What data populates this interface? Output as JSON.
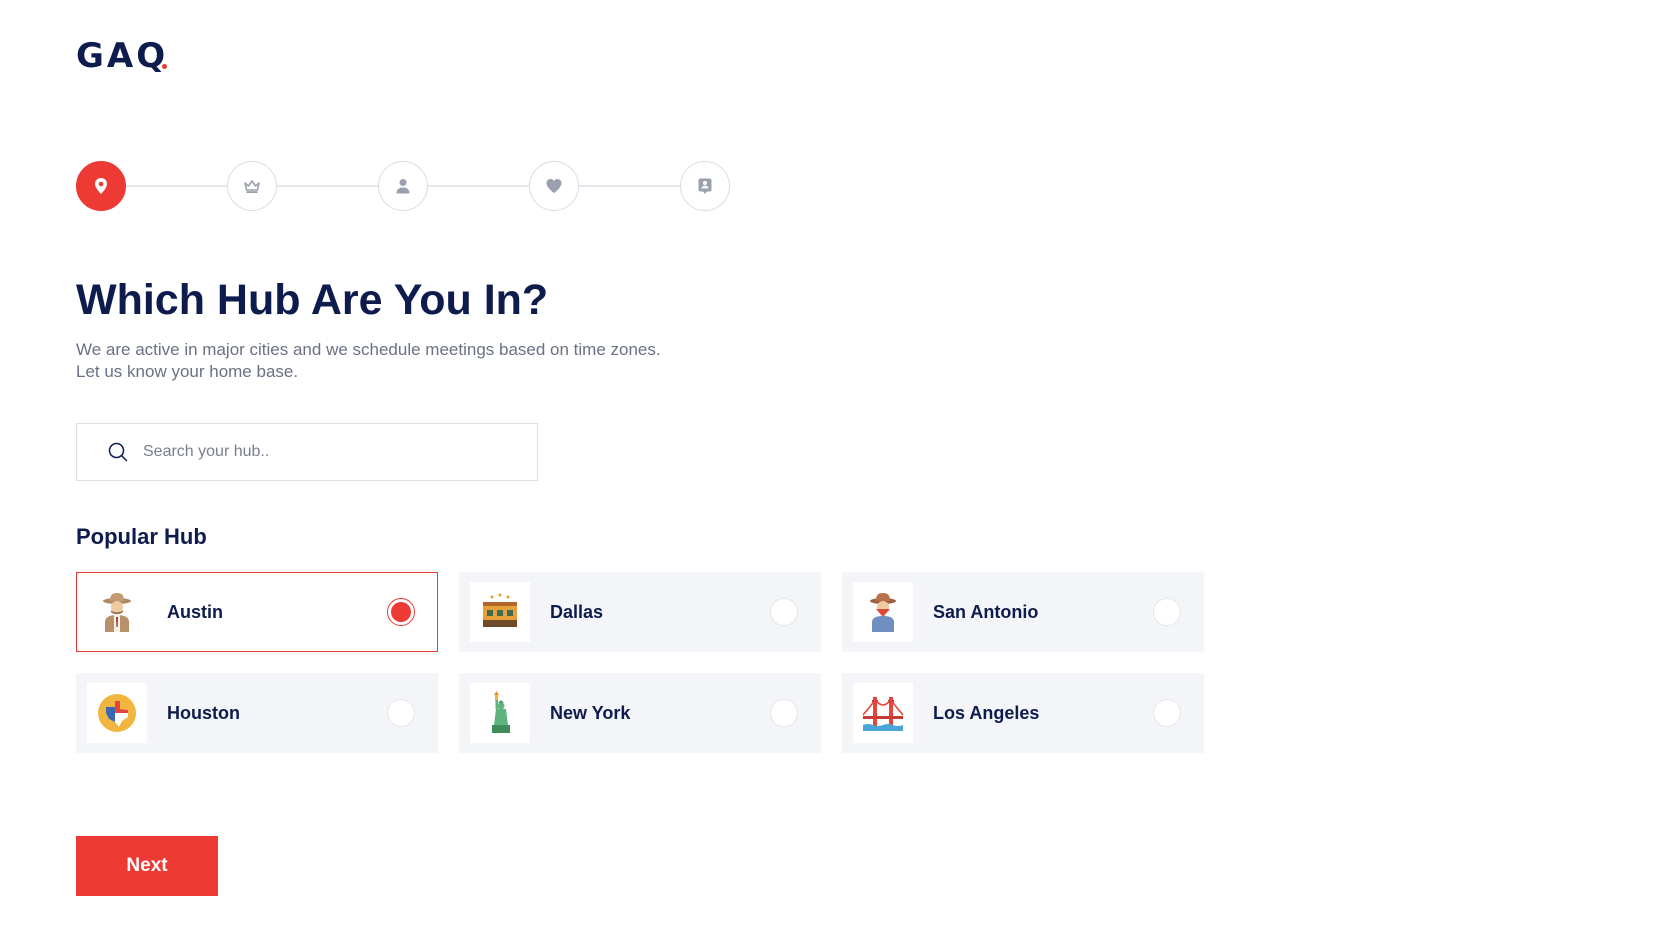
{
  "logo": {
    "text": "GAQ"
  },
  "colors": {
    "accent": "#ee3a35",
    "navy": "#0e1b4d",
    "muted": "#6b7185",
    "card_bg": "#f3f5f8"
  },
  "stepper": {
    "current_step": 1,
    "steps": [
      {
        "icon": "location-pin-icon",
        "active": true
      },
      {
        "icon": "crown-icon",
        "active": false
      },
      {
        "icon": "user-icon",
        "active": false
      },
      {
        "icon": "heart-icon",
        "active": false
      },
      {
        "icon": "contact-card-icon",
        "active": false
      }
    ]
  },
  "header": {
    "title": "Which Hub Are You In?",
    "subtitle_line1": "We are active in major cities and we schedule meetings based on time zones.",
    "subtitle_line2": "Let us know your home base."
  },
  "search": {
    "placeholder": "Search your hub..",
    "value": ""
  },
  "popular": {
    "title": "Popular Hub",
    "hubs": [
      {
        "name": "Austin",
        "icon": "cowboy-icon",
        "selected": true
      },
      {
        "name": "Dallas",
        "icon": "building-icon",
        "selected": false
      },
      {
        "name": "San Antonio",
        "icon": "cowboy-bandana-icon",
        "selected": false
      },
      {
        "name": "Houston",
        "icon": "texas-map-icon",
        "selected": false
      },
      {
        "name": "New York",
        "icon": "statue-of-liberty-icon",
        "selected": false
      },
      {
        "name": "Los Angeles",
        "icon": "golden-gate-bridge-icon",
        "selected": false
      }
    ]
  },
  "footer": {
    "next_label": "Next"
  }
}
